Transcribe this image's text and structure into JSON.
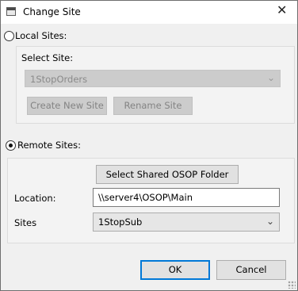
{
  "window": {
    "title": "Change Site",
    "close_glyph": "✕"
  },
  "local": {
    "radio_label": "Local Sites:",
    "selected": false,
    "select_site_label": "Select Site:",
    "site_value": "1StopOrders",
    "create_button": "Create New Site",
    "rename_button": "Rename Site"
  },
  "remote": {
    "radio_label": "Remote Sites:",
    "selected": true,
    "select_folder_button": "Select Shared OSOP Folder",
    "location_label": "Location:",
    "location_value": "\\\\server4\\OSOP\\Main",
    "sites_label": "Sites",
    "sites_value": "1StopSub"
  },
  "footer": {
    "ok_label": "OK",
    "cancel_label": "Cancel"
  },
  "icons": {
    "dropdown": "chevron-down-icon",
    "close": "close-icon",
    "app": "window-icon"
  }
}
